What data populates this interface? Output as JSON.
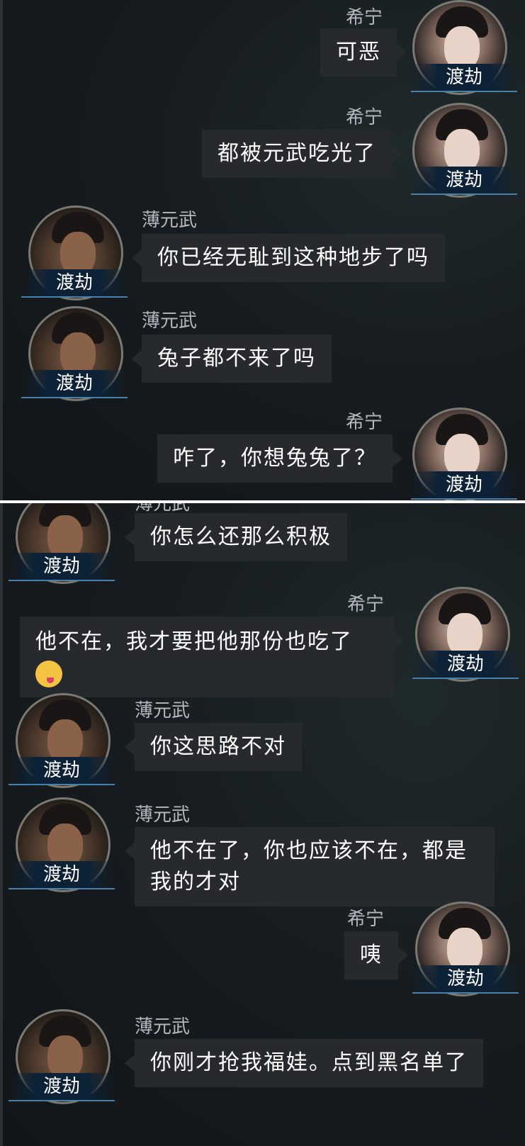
{
  "badge_label": "渡劫",
  "characters": {
    "female": {
      "name": "希宁"
    },
    "male": {
      "name": "薄元武"
    }
  },
  "top_messages": [
    {
      "speaker": "希宁",
      "text": "可恶"
    },
    {
      "speaker": "希宁",
      "text": "都被元武吃光了"
    },
    {
      "speaker": "薄元武",
      "text": "你已经无耻到这种地步了吗"
    },
    {
      "speaker": "薄元武",
      "text": "兔子都不来了吗"
    },
    {
      "speaker": "希宁",
      "text": "咋了，你想兔兔了？"
    }
  ],
  "bottom_messages": [
    {
      "speaker": "薄元武",
      "text": "你怎么还那么积极"
    },
    {
      "speaker": "希宁",
      "text": "他不在，我才要把他那份也吃了",
      "emoji": "savoring-food-emoji"
    },
    {
      "speaker": "薄元武",
      "text": "你这思路不对"
    },
    {
      "speaker": "薄元武",
      "text": "他不在了，你也应该不在，都是我的才对"
    },
    {
      "speaker": "希宁",
      "text": "咦"
    },
    {
      "speaker": "薄元武",
      "text": "你刚才抢我福娃。点到黑名单了"
    }
  ]
}
